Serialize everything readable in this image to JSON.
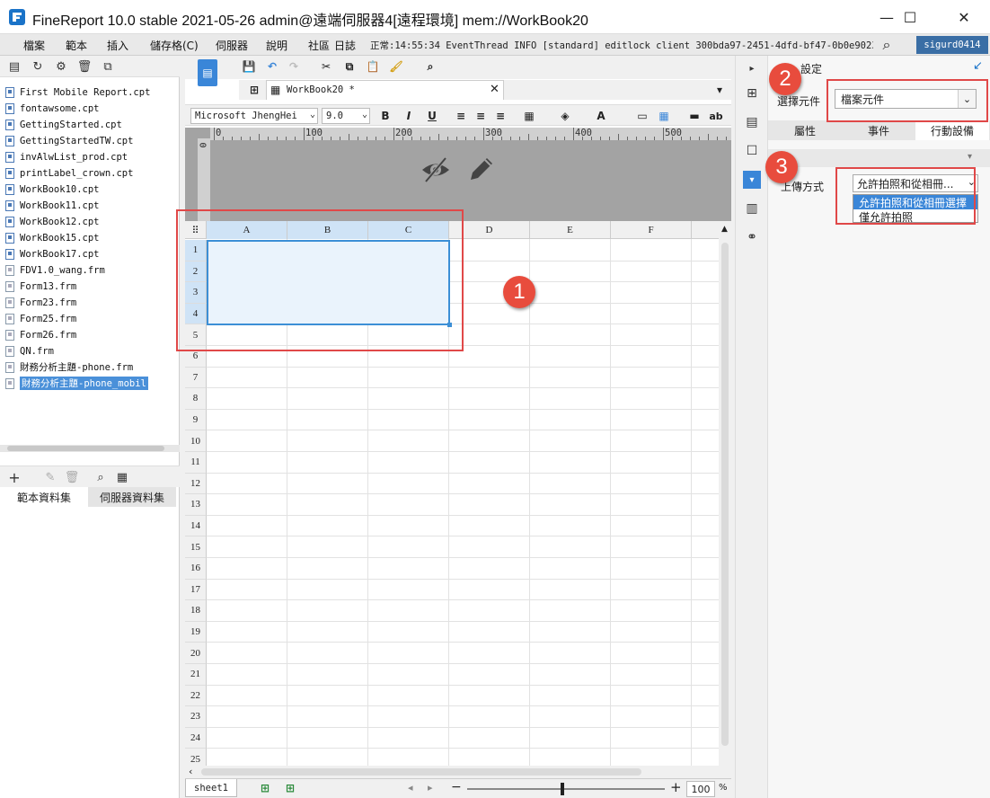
{
  "window": {
    "title": "FineReport 10.0 stable 2021-05-26 admin@遠端伺服器4[遠程環境]    mem://WorkBook20",
    "minimize_icon": "minimize-icon",
    "maximize_icon": "maximize-icon",
    "close_icon": "close-icon"
  },
  "menubar": {
    "items": [
      "檔案",
      "範本",
      "插入",
      "儲存格(C)",
      "伺服器",
      "說明",
      "社區",
      "日誌"
    ],
    "status_text": "正常:14:55:34 EventThread INFO [standard] editlock client 300bda97-2451-4dfd-bf47-0b0e9023...",
    "user": "sigurd0414"
  },
  "file_list": {
    "items": [
      {
        "name": "First Mobile Report.cpt",
        "type": "cpt"
      },
      {
        "name": "fontawsome.cpt",
        "type": "cpt"
      },
      {
        "name": "GettingStarted.cpt",
        "type": "cpt"
      },
      {
        "name": "GettingStartedTW.cpt",
        "type": "cpt"
      },
      {
        "name": "invAlwList_prod.cpt",
        "type": "cpt"
      },
      {
        "name": "printLabel_crown.cpt",
        "type": "cpt"
      },
      {
        "name": "WorkBook10.cpt",
        "type": "cpt"
      },
      {
        "name": "WorkBook11.cpt",
        "type": "cpt"
      },
      {
        "name": "WorkBook12.cpt",
        "type": "cpt"
      },
      {
        "name": "WorkBook15.cpt",
        "type": "cpt"
      },
      {
        "name": "WorkBook17.cpt",
        "type": "cpt"
      },
      {
        "name": "FDV1.0_wang.frm",
        "type": "frm"
      },
      {
        "name": "Form13.frm",
        "type": "frm"
      },
      {
        "name": "Form23.frm",
        "type": "frm"
      },
      {
        "name": "Form25.frm",
        "type": "frm"
      },
      {
        "name": "Form26.frm",
        "type": "frm"
      },
      {
        "name": "QN.frm",
        "type": "frm"
      },
      {
        "name": "財務分析主題-phone.frm",
        "type": "frm"
      },
      {
        "name": "財務分析主題-phone_mobil",
        "type": "frm",
        "selected": true
      }
    ],
    "tabs": [
      "範本資料集",
      "伺服器資料集"
    ]
  },
  "editor": {
    "doc_tab": "WorkBook20 *",
    "font_name": "Microsoft JhengHei",
    "font_size": "9.0",
    "ruler_labels": [
      "0",
      "100",
      "200",
      "300",
      "400",
      "500"
    ],
    "columns": [
      "A",
      "B",
      "C",
      "D",
      "E",
      "F"
    ],
    "rows": [
      "1",
      "2",
      "3",
      "4",
      "5",
      "6",
      "7",
      "8",
      "9",
      "10",
      "11",
      "12",
      "13",
      "14",
      "15",
      "16",
      "17",
      "18",
      "19",
      "20",
      "21",
      "22",
      "23",
      "24",
      "25"
    ],
    "sheet_tab": "sheet1",
    "zoom": "100",
    "zoom_unit": "%"
  },
  "right_panel": {
    "title": "設定",
    "select_label": "選擇元件",
    "select_value": "檔案元件",
    "tabs": [
      "屬性",
      "事件",
      "行動設備"
    ],
    "active_tab": 2,
    "section": "端",
    "upload_label": "上傳方式",
    "upload_value": "允許拍照和從相冊...",
    "upload_options": [
      "允許拍照和從相冊選擇",
      "僅允許拍照"
    ]
  },
  "annotations": [
    "1",
    "2",
    "3"
  ],
  "colors": {
    "accent": "#3c8fd6",
    "callout": "#e04848",
    "badge": "#e84c3d"
  }
}
